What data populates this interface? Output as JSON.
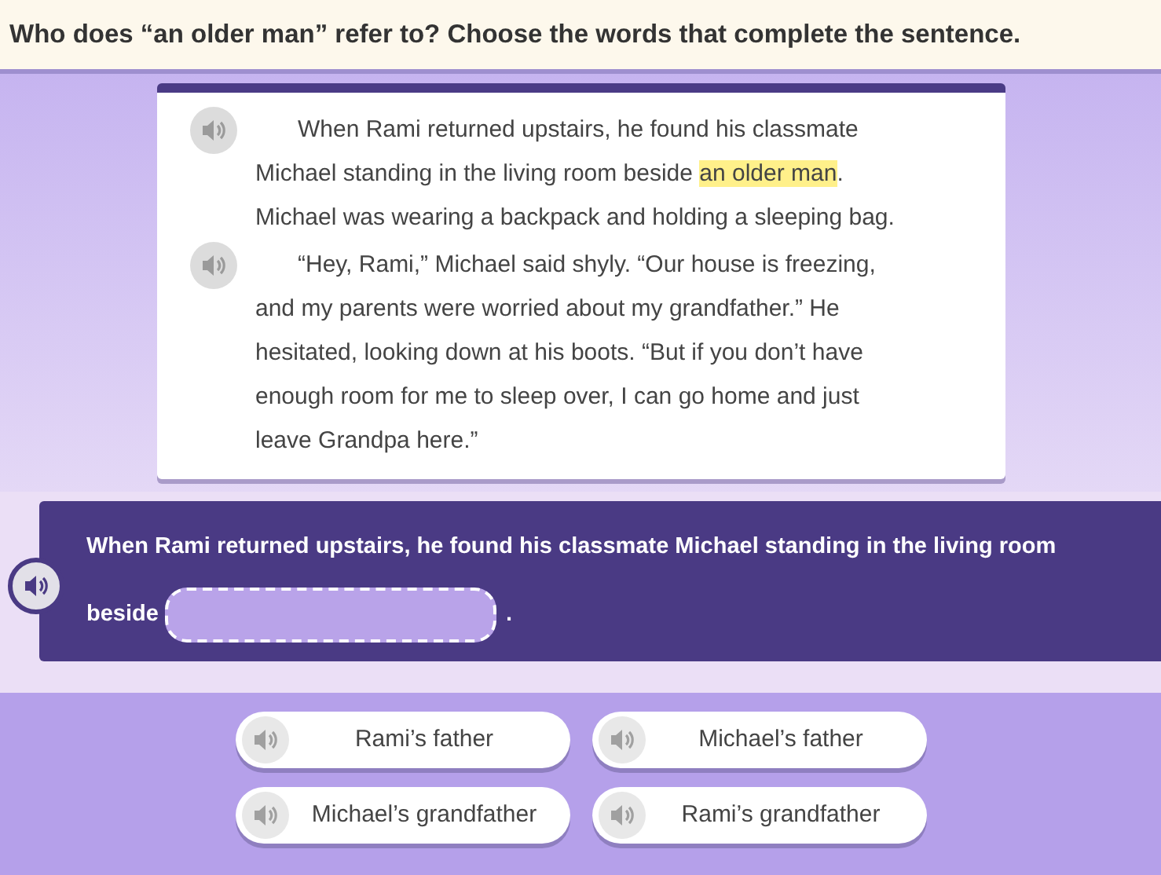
{
  "question": "Who does “an older man” refer to? Choose the words that complete the sentence.",
  "passage": [
    {
      "parts": [
        {
          "text": "When Rami returned upstairs, he found his classmate Michael standing in the living room beside ",
          "highlighted": false
        },
        {
          "text": "an older man",
          "highlighted": true
        },
        {
          "text": ". Michael was wearing a backpack and holding a sleeping bag.",
          "highlighted": false
        }
      ]
    },
    {
      "parts": [
        {
          "text": "“Hey, Rami,” Michael said shyly. “Our house is freezing, and my parents were worried about my grandfather.” He hesitated, looking down at his boots. “But if you don’t have enough room for me to sleep over, I can go home and just leave Grandpa here.”",
          "highlighted": false
        }
      ]
    }
  ],
  "sentence": {
    "before": "When Rami returned upstairs, he found his classmate Michael standing in the living room beside",
    "after": "."
  },
  "options": [
    {
      "label": "Rami’s father",
      "selected": false
    },
    {
      "label": "Michael’s father",
      "selected": false
    },
    {
      "label": "Michael’s grandfather",
      "selected": false
    },
    {
      "label": "Rami’s grandfather",
      "selected": false
    }
  ]
}
